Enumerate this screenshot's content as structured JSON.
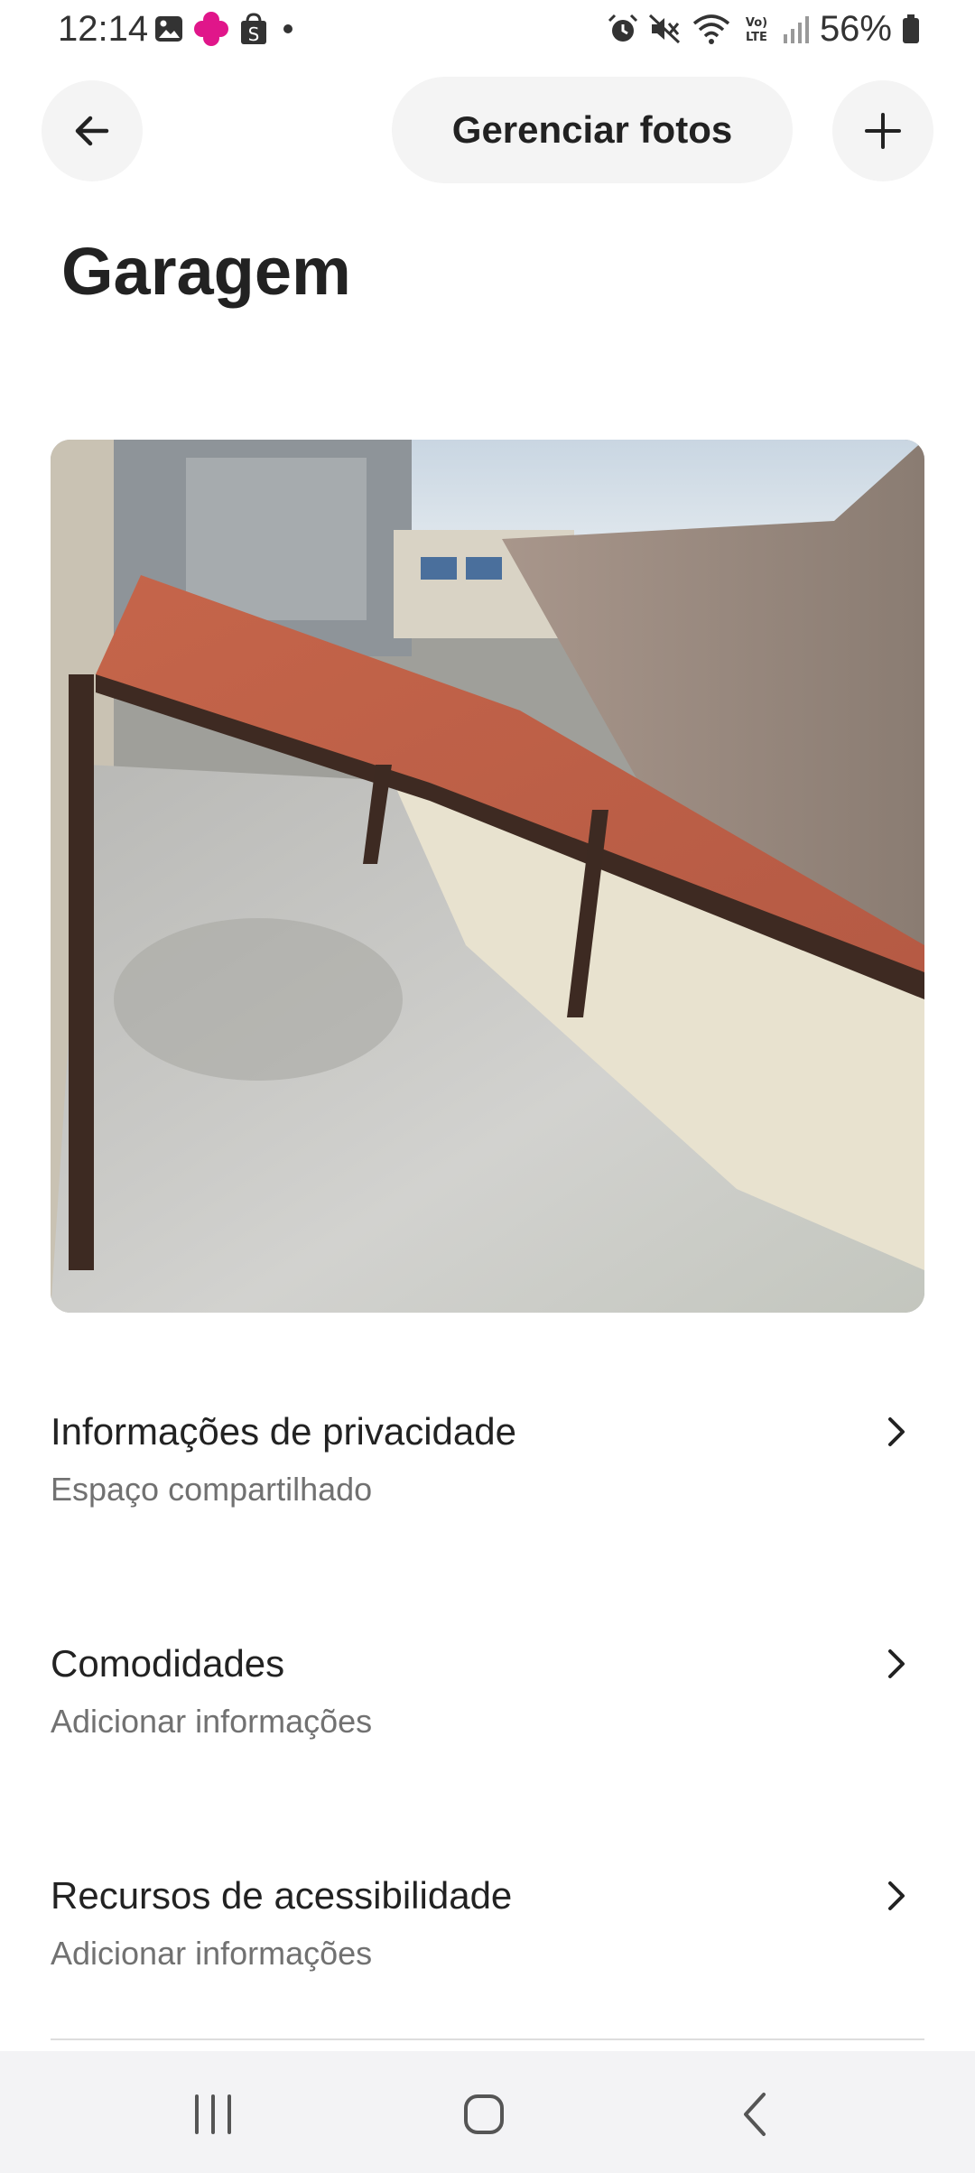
{
  "status_bar": {
    "time": "12:14",
    "battery": "56%",
    "left_icons": [
      "image-icon",
      "app-flower-icon",
      "shopping-bag-icon",
      "dot-icon"
    ],
    "right_icons": [
      "alarm-icon",
      "mute-icon",
      "wifi-icon",
      "volte-icon",
      "signal-icon",
      "battery-icon"
    ],
    "accent_color": "#e0168a"
  },
  "header": {
    "back_icon": "arrow-left-icon",
    "manage_label": "Gerenciar fotos",
    "add_icon": "plus-icon"
  },
  "page": {
    "title": "Garagem"
  },
  "photo": {
    "subject": "covered garage with red roof"
  },
  "rows": [
    {
      "title": "Informações de privacidade",
      "subtitle": "Espaço compartilhado"
    },
    {
      "title": "Comodidades",
      "subtitle": "Adicionar informações"
    },
    {
      "title": "Recursos de acessibilidade",
      "subtitle": "Adicionar informações"
    }
  ],
  "nav": {
    "icons": [
      "recent-apps-icon",
      "home-icon",
      "back-nav-icon"
    ]
  }
}
